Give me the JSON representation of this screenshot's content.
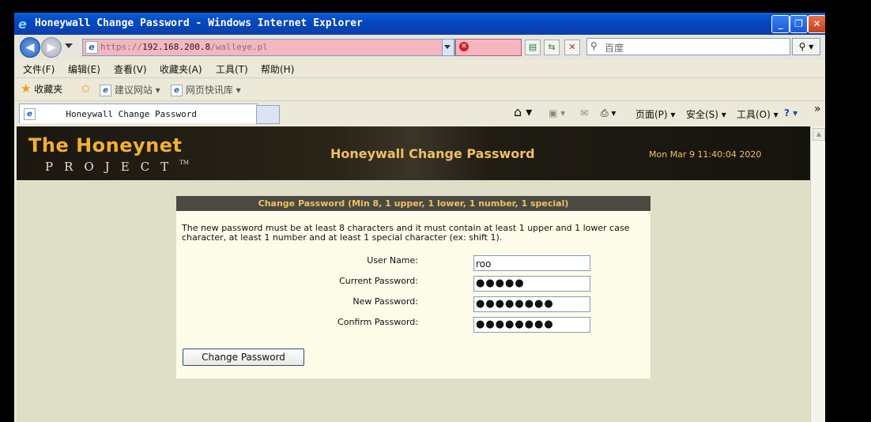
{
  "window": {
    "title": "Honeywall Change Password - Windows Internet Explorer"
  },
  "addressbar": {
    "url_scheme": "https://",
    "url_host": "192.168.200.8",
    "url_path": "/walleye.pl",
    "cert_error": "证书错误"
  },
  "search": {
    "placeholder": "百度"
  },
  "menu": {
    "items": [
      "文件(F)",
      "编辑(E)",
      "查看(V)",
      "收藏夹(A)",
      "工具(T)",
      "帮助(H)"
    ]
  },
  "favorites": {
    "label": "收藏夹",
    "items": [
      "建议网站 ▾",
      "网页快讯库 ▾"
    ]
  },
  "tab": {
    "title": "Honeywall Change Password"
  },
  "commandbar": {
    "page": "页面(P) ▾",
    "safety": "安全(S) ▾",
    "tools": "工具(O) ▾",
    "more": "»"
  },
  "banner": {
    "logo_top": "The Honeynet",
    "logo_bottom": "PROJECT",
    "logo_tm": "TM",
    "title": "Honeywall Change Password",
    "datetime": "Mon Mar 9 11:40:04 2020"
  },
  "form": {
    "header": "Change Password (Min 8, 1 upper, 1 lower, 1 number, 1 special)",
    "description": "The new password must be at least 8 characters and it must contain at least 1 upper and 1 lower case character, at least 1 number and at least 1 special character (ex: shift 1).",
    "fields": [
      {
        "label": "User Name:",
        "value": "roo"
      },
      {
        "label": "Current Password:",
        "value": "●●●●●"
      },
      {
        "label": "New Password:",
        "value": "●●●●●●●●"
      },
      {
        "label": "Confirm Password:",
        "value": "●●●●●●●●"
      }
    ],
    "submit_label": "Change Password"
  }
}
